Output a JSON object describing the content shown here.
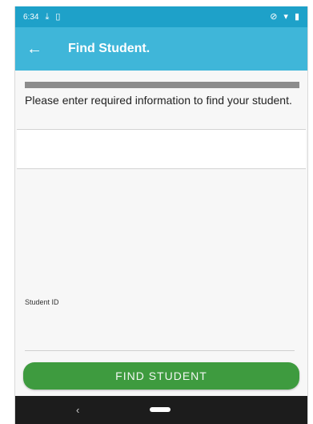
{
  "status_bar": {
    "time": "6:34",
    "left_icons": [
      "download-icon",
      "sd-card-icon"
    ],
    "right_icons": [
      "mute-icon",
      "wifi-icon",
      "battery-icon"
    ]
  },
  "app_bar": {
    "back_icon": "arrow-left-icon",
    "title": "Find Student."
  },
  "form": {
    "instructions": "Please enter required information to find your student.",
    "student_id_label": "Student ID",
    "student_id_value": ""
  },
  "buttons": {
    "find_student": "FIND STUDENT"
  },
  "nav_bar": {
    "back_icon": "chevron-left-icon",
    "home_icon": "home-pill-icon"
  },
  "colors": {
    "status_bar": "#1ea1c9",
    "app_bar": "#3fb6d9",
    "button": "#3e9b3f",
    "nav_bar": "#1c1c1c"
  }
}
